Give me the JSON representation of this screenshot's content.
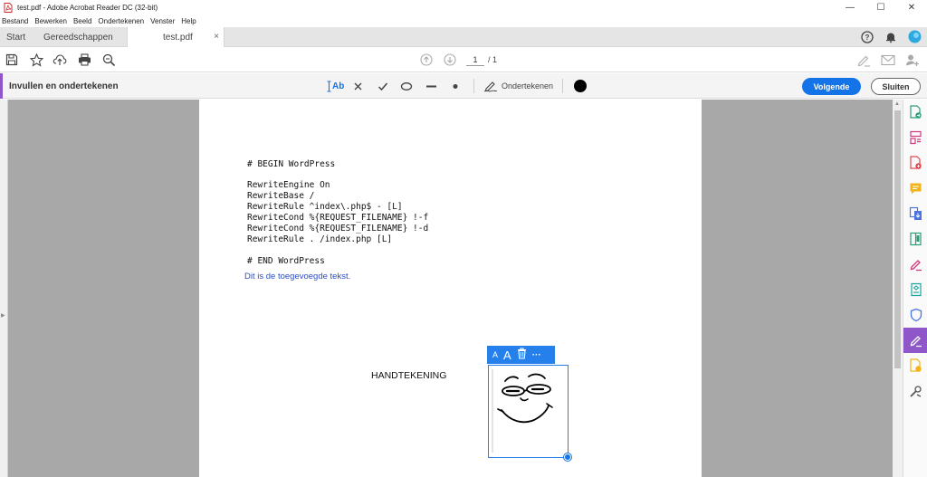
{
  "window": {
    "title": "test.pdf - Adobe Acrobat Reader DC (32-bit)",
    "minimize": "—",
    "maximize": "☐",
    "close": "✕"
  },
  "menu": [
    "Bestand",
    "Bewerken",
    "Beeld",
    "Ondertekenen",
    "Venster",
    "Help"
  ],
  "tabs": {
    "start": "Start",
    "tools": "Gereedschappen",
    "document": "test.pdf",
    "close": "×"
  },
  "toolbar": {
    "page_current": "1",
    "page_total": "/ 1"
  },
  "fill_sign": {
    "title": "Invullen en ondertekenen",
    "text_tool": "Ab",
    "sign_label": "Ondertekenen",
    "next_button": "Volgende",
    "close_button": "Sluiten",
    "ink_color": "#000000",
    "accent_color": "#8e56c8"
  },
  "document": {
    "code_lines": [
      "# BEGIN WordPress",
      "",
      "RewriteEngine On",
      "RewriteBase /",
      "RewriteRule ^index\\.php$ - [L]",
      "RewriteCond %{REQUEST_FILENAME} !-f",
      "RewriteCond %{REQUEST_FILENAME} !-d",
      "RewriteRule . /index.php [L]",
      "",
      "# END WordPress"
    ],
    "added_text": "Dit is de toegevoegde tekst.",
    "signature_label": "HANDTEKENING",
    "annotation_toolbar": {
      "small_a": "A",
      "big_a": "A",
      "more": "···"
    }
  },
  "colors": {
    "primary": "#1473e6",
    "selection": "#2680eb",
    "added_text": "#2b4ec7",
    "canvas": "#a8a8a8"
  }
}
